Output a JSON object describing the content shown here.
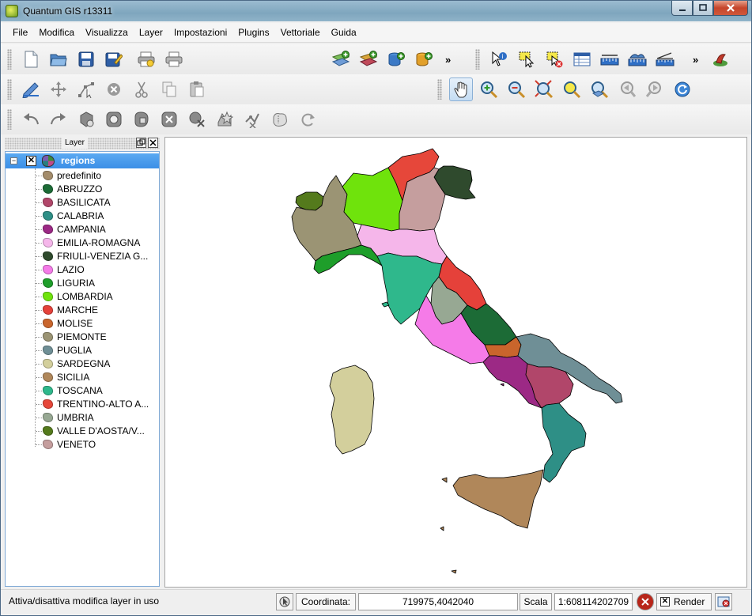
{
  "window": {
    "title": "Quantum GIS r13311"
  },
  "menu": [
    "File",
    "Modifica",
    "Visualizza",
    "Layer",
    "Impostazioni",
    "Plugins",
    "Vettoriale",
    "Guida"
  ],
  "toolbar": {
    "overflow_label": "»"
  },
  "panel": {
    "title": "Layer"
  },
  "legend": {
    "layer": {
      "name": "regions",
      "visible": true,
      "expanded": true
    },
    "classes": [
      {
        "label": "predefinito",
        "color": "#a38c6b"
      },
      {
        "label": "ABRUZZO",
        "color": "#1c6b36"
      },
      {
        "label": "BASILICATA",
        "color": "#b1466a"
      },
      {
        "label": "CALABRIA",
        "color": "#2e8f86"
      },
      {
        "label": "CAMPANIA",
        "color": "#9c2985"
      },
      {
        "label": "EMILIA-ROMAGNA",
        "color": "#f5b6ea"
      },
      {
        "label": "FRIULI-VENEZIA G...",
        "color": "#2f4a2d"
      },
      {
        "label": "LAZIO",
        "color": "#f57be8"
      },
      {
        "label": "LIGURIA",
        "color": "#1e9e2a"
      },
      {
        "label": "LOMBARDIA",
        "color": "#6fe30c"
      },
      {
        "label": "MARCHE",
        "color": "#e5413a"
      },
      {
        "label": "MOLISE",
        "color": "#c9652c"
      },
      {
        "label": "PIEMONTE",
        "color": "#9b9474"
      },
      {
        "label": "PUGLIA",
        "color": "#6f8f96"
      },
      {
        "label": "SARDEGNA",
        "color": "#d3cf9c"
      },
      {
        "label": "SICILIA",
        "color": "#b0875a"
      },
      {
        "label": "TOSCANA",
        "color": "#2fb88c"
      },
      {
        "label": "TRENTINO-ALTO A...",
        "color": "#e6473a"
      },
      {
        "label": "UMBRIA",
        "color": "#97a893"
      },
      {
        "label": "VALLE D'AOSTA/V...",
        "color": "#547a1c"
      },
      {
        "label": "VENETO",
        "color": "#c59e9e"
      }
    ]
  },
  "statusbar": {
    "message": "Attiva/disattiva modifica layer in uso",
    "coord_label": "Coordinata:",
    "coord_value": "719975,4042040",
    "scale_label": "Scala",
    "scale_value": "1:608114202709",
    "render_label": "Render",
    "render_checked": true
  }
}
